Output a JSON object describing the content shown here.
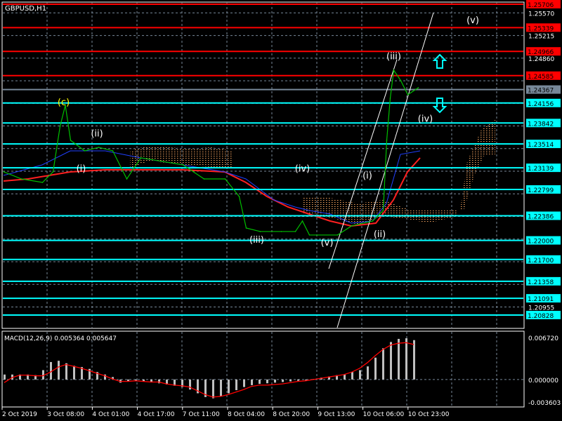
{
  "chart_data": [
    {
      "type": "line",
      "title": "GBPUSD,H1",
      "symbol": "GBPUSD",
      "timeframe": "H1",
      "ylim": [
        1.20828,
        1.25706
      ],
      "axis_ticks": [
        "1.25570",
        "1.25215",
        "1.24860",
        "1.20955"
      ],
      "current_price": {
        "value": 1.24367,
        "label": "1.24367",
        "color": "#778899"
      },
      "levels": [
        {
          "value": 1.25706,
          "label": "1.25706",
          "color": "#ff0000"
        },
        {
          "value": 1.25339,
          "label": "1.25339",
          "color": "#ff0000"
        },
        {
          "value": 1.24966,
          "label": "1.24966",
          "color": "#ff0000"
        },
        {
          "value": 1.24585,
          "label": "1.24585",
          "color": "#ff0000"
        },
        {
          "value": 1.24156,
          "label": "1.24156",
          "color": "#00ffff"
        },
        {
          "value": 1.23842,
          "label": "1.23842",
          "color": "#00ffff"
        },
        {
          "value": 1.23514,
          "label": "1.23514",
          "color": "#00ffff"
        },
        {
          "value": 1.23139,
          "label": "1.23139",
          "color": "#00ffff"
        },
        {
          "value": 1.22799,
          "label": "1.22799",
          "color": "#00ffff"
        },
        {
          "value": 1.22386,
          "label": "1.22386",
          "color": "#00ffff"
        },
        {
          "value": 1.22,
          "label": "1.22000",
          "color": "#00ffff"
        },
        {
          "value": 1.217,
          "label": "1.21700",
          "color": "#00ffff"
        },
        {
          "value": 1.21358,
          "label": "1.21358",
          "color": "#00ffff"
        },
        {
          "value": 1.21091,
          "label": "1.21091",
          "color": "#00ffff"
        },
        {
          "value": 1.20828,
          "label": "1.20828",
          "color": "#00ffff"
        }
      ],
      "x_labels": [
        "2 Oct 2019",
        "3 Oct 08:00",
        "4 Oct 01:00",
        "4 Oct 17:00",
        "7 Oct 11:00",
        "8 Oct 04:00",
        "8 Oct 20:00",
        "9 Oct 13:00",
        "10 Oct 06:00",
        "10 Oct 23:00"
      ],
      "price_series": {
        "name": "GBPUSD close",
        "color": "#00c000",
        "points": [
          [
            1,
            1.23075
          ],
          [
            11,
            1.22964
          ],
          [
            23,
            1.22909
          ],
          [
            29,
            1.23075
          ],
          [
            33,
            1.2379
          ],
          [
            36,
            1.2412
          ],
          [
            39,
            1.2357
          ],
          [
            47,
            1.23405
          ],
          [
            55,
            1.2346
          ],
          [
            63,
            1.23405
          ],
          [
            71,
            1.22964
          ],
          [
            79,
            1.23295
          ],
          [
            91,
            1.2324
          ],
          [
            103,
            1.23185
          ],
          [
            115,
            1.22964
          ],
          [
            127,
            1.22964
          ],
          [
            135,
            1.22689
          ],
          [
            139,
            1.22194
          ],
          [
            147,
            1.22139
          ],
          [
            159,
            1.22139
          ],
          [
            167,
            1.22139
          ],
          [
            171,
            1.22304
          ],
          [
            175,
            1.22084
          ],
          [
            191,
            1.22084
          ],
          [
            199,
            1.22227
          ],
          [
            211,
            1.22304
          ],
          [
            217,
            1.22469
          ],
          [
            219,
            1.2357
          ],
          [
            221,
            1.24231
          ],
          [
            223,
            1.24671
          ],
          [
            227,
            1.24506
          ],
          [
            231,
            1.24286
          ],
          [
            237,
            1.24396
          ]
        ]
      },
      "wave_labels": [
        {
          "text": "(c)",
          "color": "#ffff00",
          "hour": 35,
          "price": 1.2412
        },
        {
          "text": "(ii)",
          "color": "#ffffff",
          "hour": 54,
          "price": 1.2363
        },
        {
          "text": "(i)",
          "color": "#ffffff",
          "hour": 45,
          "price": 1.2308
        },
        {
          "text": "(iv)",
          "color": "#ffffff",
          "hour": 171,
          "price": 1.2308
        },
        {
          "text": "(iii)",
          "color": "#ffffff",
          "hour": 145,
          "price": 1.2196
        },
        {
          "text": "(v)",
          "color": "#ffffff",
          "hour": 185,
          "price": 1.2192
        },
        {
          "text": "(i)",
          "color": "#ffffff",
          "hour": 208,
          "price": 1.2297
        },
        {
          "text": "(ii)",
          "color": "#ffffff",
          "hour": 215,
          "price": 1.2205
        },
        {
          "text": "(iii)",
          "color": "#ffffff",
          "hour": 223,
          "price": 1.2484
        },
        {
          "text": "(iv)",
          "color": "#ffffff",
          "hour": 241,
          "price": 1.2386
        },
        {
          "text": "(v)",
          "color": "#ffffff",
          "hour": 268,
          "price": 1.2541
        }
      ]
    },
    {
      "type": "bar",
      "title": "MACD(12,26,9) 0.005364 0.005647",
      "ylim": [
        -0.003603,
        0.00672
      ],
      "axis_ticks": [
        "0.006720",
        "0.000000",
        "-0.003603"
      ],
      "histogram": [
        0.0008,
        0.0008,
        0.0008,
        0.0008,
        0.0007,
        0.0015,
        0.0028,
        0.003,
        0.0026,
        0.0022,
        0.002,
        0.0017,
        0.0012,
        0.0008,
        0.0004,
        -0.0005,
        -0.0003,
        -0.0002,
        -0.0003,
        -0.0004,
        -0.0006,
        -0.0008,
        -0.001,
        -0.0012,
        -0.0016,
        -0.0022,
        -0.0028,
        -0.003,
        -0.0027,
        -0.0022,
        -0.0017,
        -0.0012,
        -0.0009,
        -0.0007,
        -0.0006,
        -0.0005,
        -0.0004,
        -0.0003,
        -0.0002,
        -0.0001,
        0.0001,
        0.0003,
        0.0005,
        0.0007,
        0.0008,
        0.0012,
        0.0015,
        0.0021,
        0.0035,
        0.005,
        0.006,
        0.0065,
        0.0066,
        0.0063
      ],
      "signal": [
        -0.0005,
        0.0003,
        0.0007,
        0.0007,
        0.0006,
        0.0006,
        0.0012,
        0.002,
        0.0024,
        0.0021,
        0.0018,
        0.0014,
        0.001,
        0.0006,
        0.0001,
        -0.0003,
        -0.0003,
        -0.0002,
        -0.0003,
        -0.0004,
        -0.0004,
        -0.0007,
        -0.0009,
        -0.001,
        -0.0012,
        -0.0018,
        -0.0024,
        -0.0028,
        -0.0027,
        -0.0024,
        -0.002,
        -0.0016,
        -0.0011,
        -0.0009,
        -0.0009,
        -0.0008,
        -0.0007,
        -0.0005,
        -0.0003,
        -0.0002,
        0.0,
        0.0002,
        0.0004,
        0.0006,
        0.0008,
        0.0012,
        0.0018,
        0.0027,
        0.0038,
        0.0048,
        0.0055,
        0.0058,
        0.0059,
        0.0056
      ],
      "histogram_color": "#c0c0c0",
      "signal_color": "#ff0000"
    }
  ]
}
